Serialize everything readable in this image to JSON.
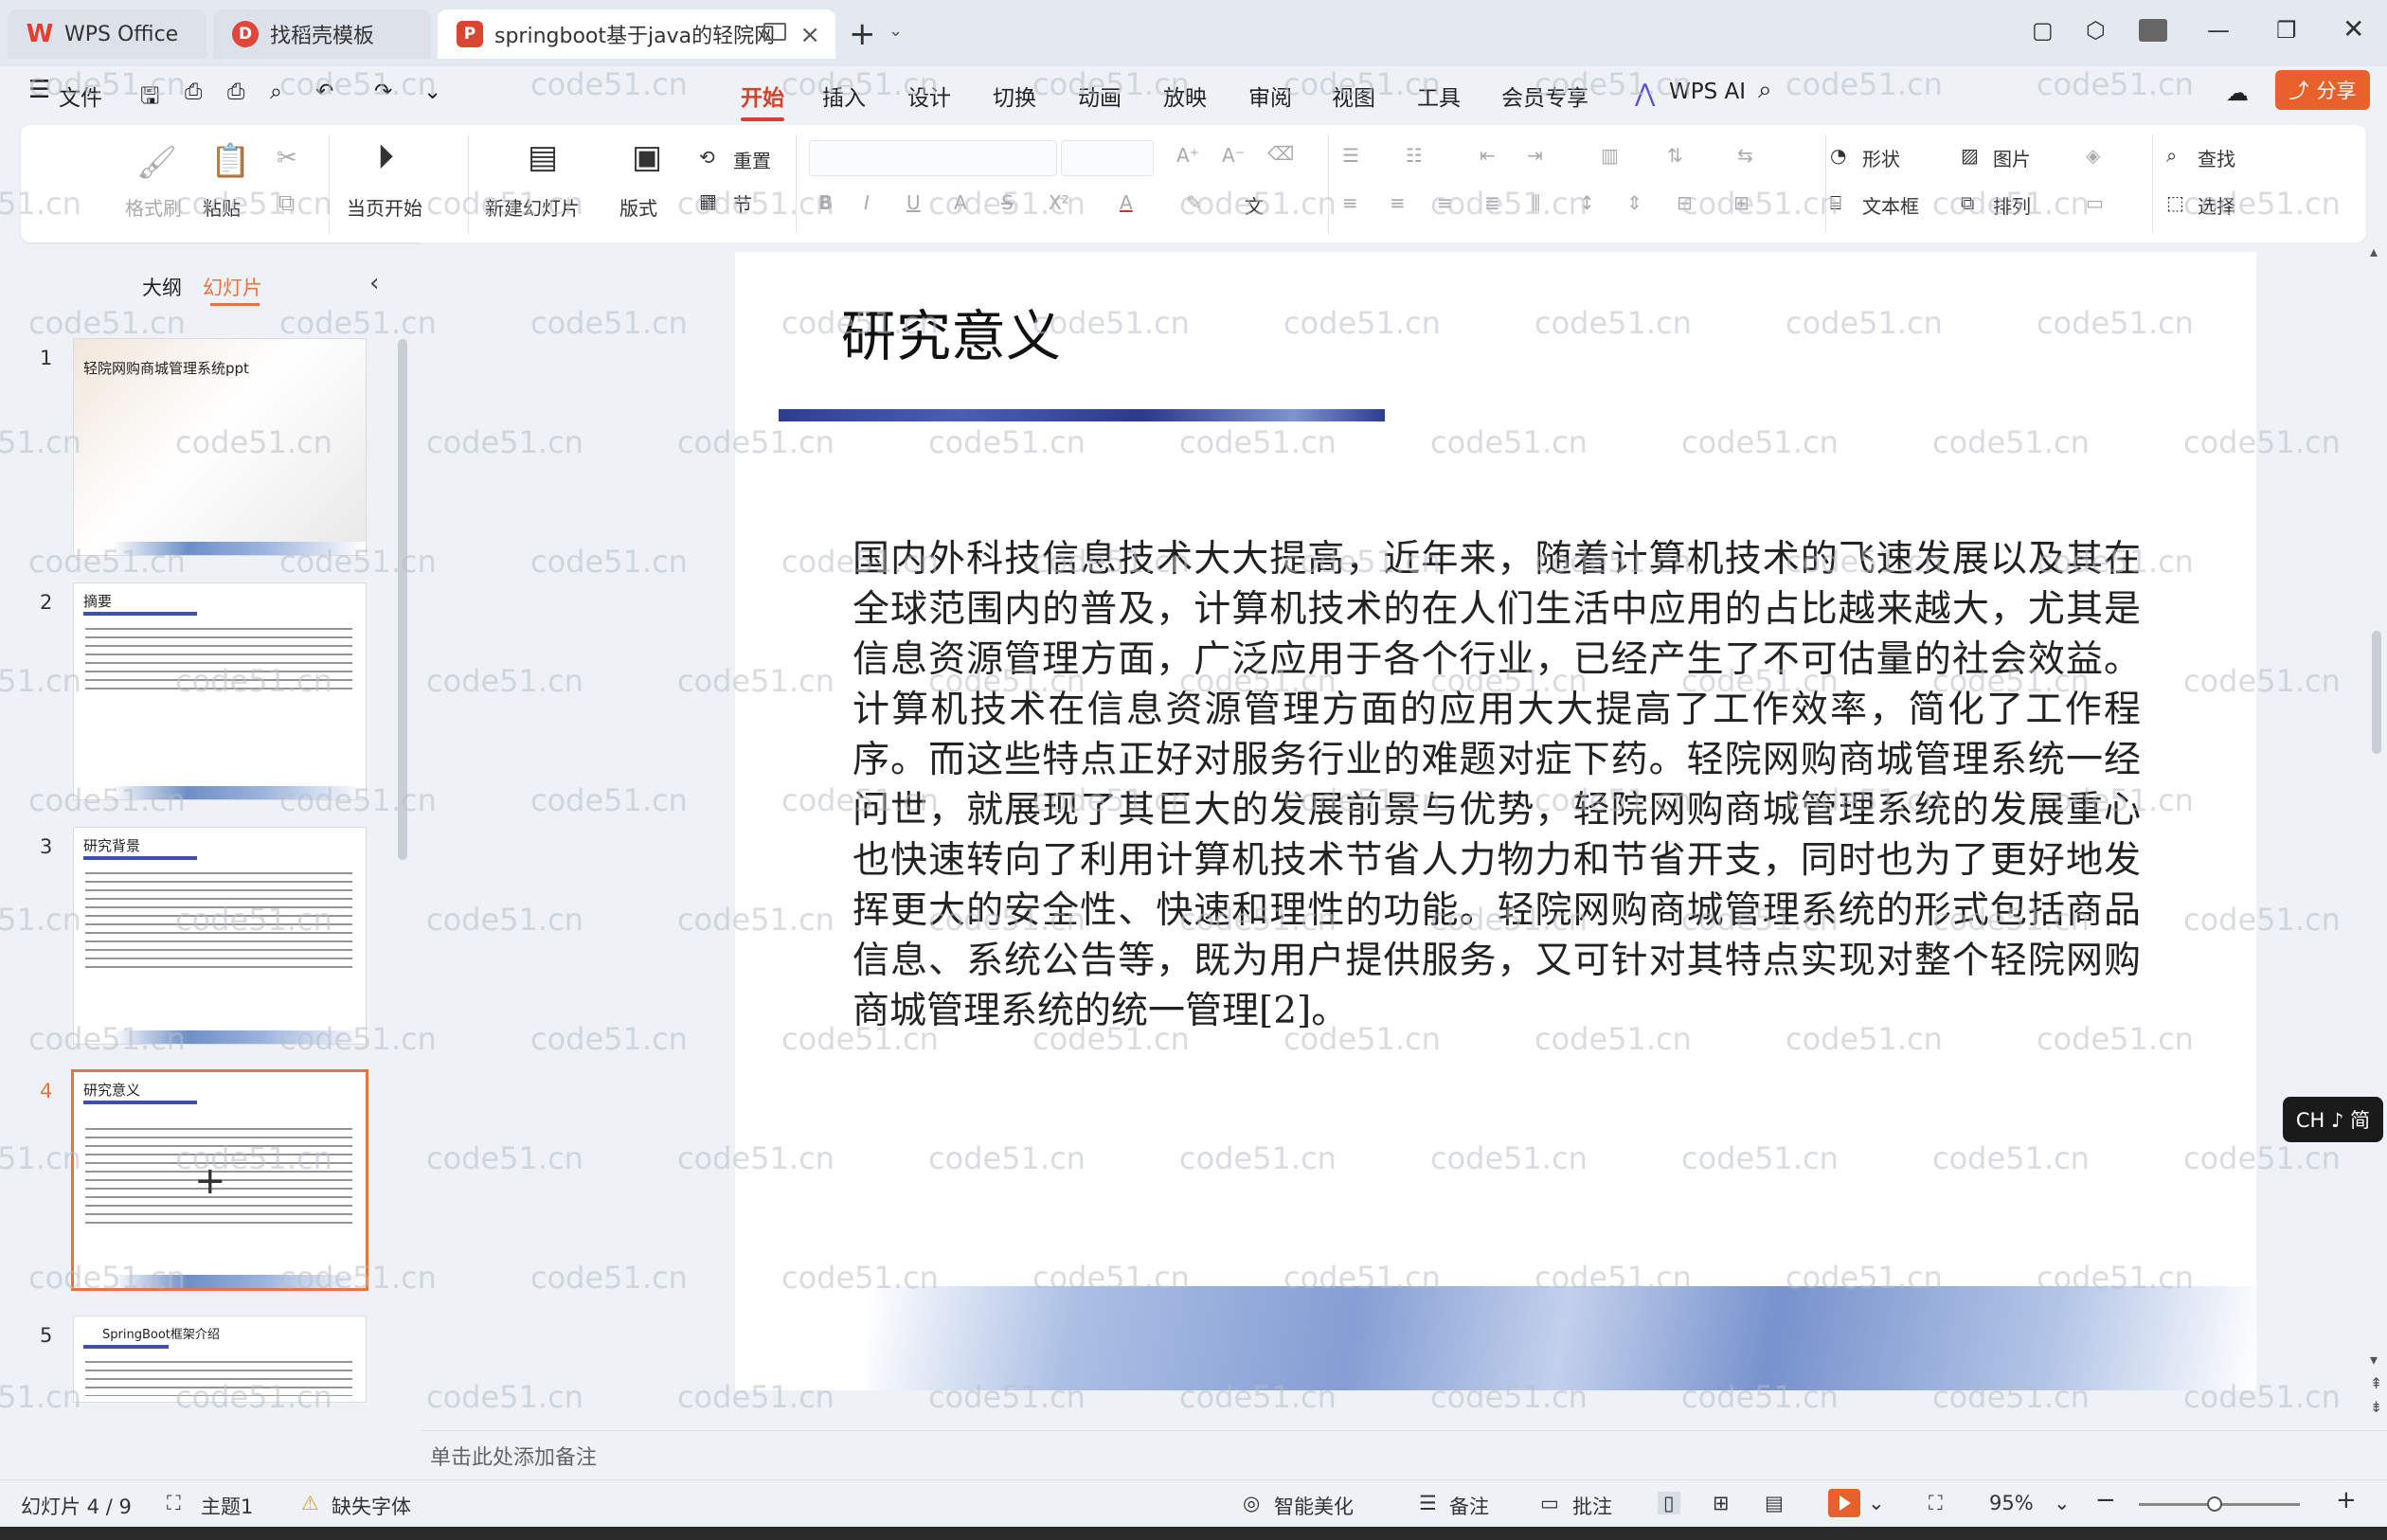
{
  "titlebar": {
    "tabs": [
      {
        "label": "WPS Office",
        "logo": "W"
      },
      {
        "label": "找稻壳模板",
        "logo": "D"
      },
      {
        "label": "springboot基于java的轻院网",
        "logo": "P"
      }
    ],
    "new_tab_label": "+"
  },
  "menubar": {
    "file_label": "文件",
    "items": [
      "开始",
      "插入",
      "设计",
      "切换",
      "动画",
      "放映",
      "审阅",
      "视图",
      "工具",
      "会员专享",
      "WPS AI"
    ],
    "active": "开始",
    "share_label": "分享"
  },
  "ribbon": {
    "format_painter": "格式刷",
    "paste": "粘贴",
    "play_from_current": "当页开始",
    "new_slide": "新建幻灯片",
    "layout": "版式",
    "reset": "重置",
    "section": "节",
    "shape": "形状",
    "picture": "图片",
    "find": "查找",
    "textbox": "文本框",
    "arrange": "排列",
    "select": "选择"
  },
  "leftpanel": {
    "tab_outline": "大纲",
    "tab_slides": "幻灯片",
    "slides": [
      {
        "num": "1",
        "title": "轻院网购商城管理系统ppt"
      },
      {
        "num": "2",
        "title": "摘要"
      },
      {
        "num": "3",
        "title": "研究背景"
      },
      {
        "num": "4",
        "title": "研究意义"
      },
      {
        "num": "5",
        "title": "SpringBoot框架介绍"
      }
    ],
    "selected": "4"
  },
  "slide": {
    "title": "研究意义",
    "body": "国内外科技信息技术大大提高，近年来，随着计算机技术的飞速发展以及其在全球范围内的普及，计算机技术的在人们生活中应用的占比越来越大，尤其是信息资源管理方面，广泛应用于各个行业，已经产生了不可估量的社会效益。计算机技术在信息资源管理方面的应用大大提高了工作效率，简化了工作程序。而这些特点正好对服务行业的难题对症下药。轻院网购商城管理系统一经问世，就展现了其巨大的发展前景与优势，轻院网购商城管理系统的发展重心也快速转向了利用计算机技术节省人力物力和节省开支，同时也为了更好地发挥更大的安全性、快速和理性的功能。轻院网购商城管理系统的形式包括商品信息、系统公告等，既为用户提供服务，又可针对其特点实现对整个轻院网购商城管理系统的统一管理[2]。"
  },
  "notes": {
    "placeholder": "单击此处添加备注"
  },
  "statusbar": {
    "slide_counter": "幻灯片 4 / 9",
    "theme": "主题1",
    "missing_font": "缺失字体",
    "smart_beautify": "智能美化",
    "notes": "备注",
    "comments": "批注",
    "zoom": "95%",
    "zoom_fraction": 0.47
  },
  "ime": {
    "label": "CH ♪ 简"
  },
  "watermark": {
    "text": "code51.cn"
  },
  "colors": {
    "accent": "#d6412a",
    "share": "#e8602a",
    "selection": "#e8743d"
  }
}
